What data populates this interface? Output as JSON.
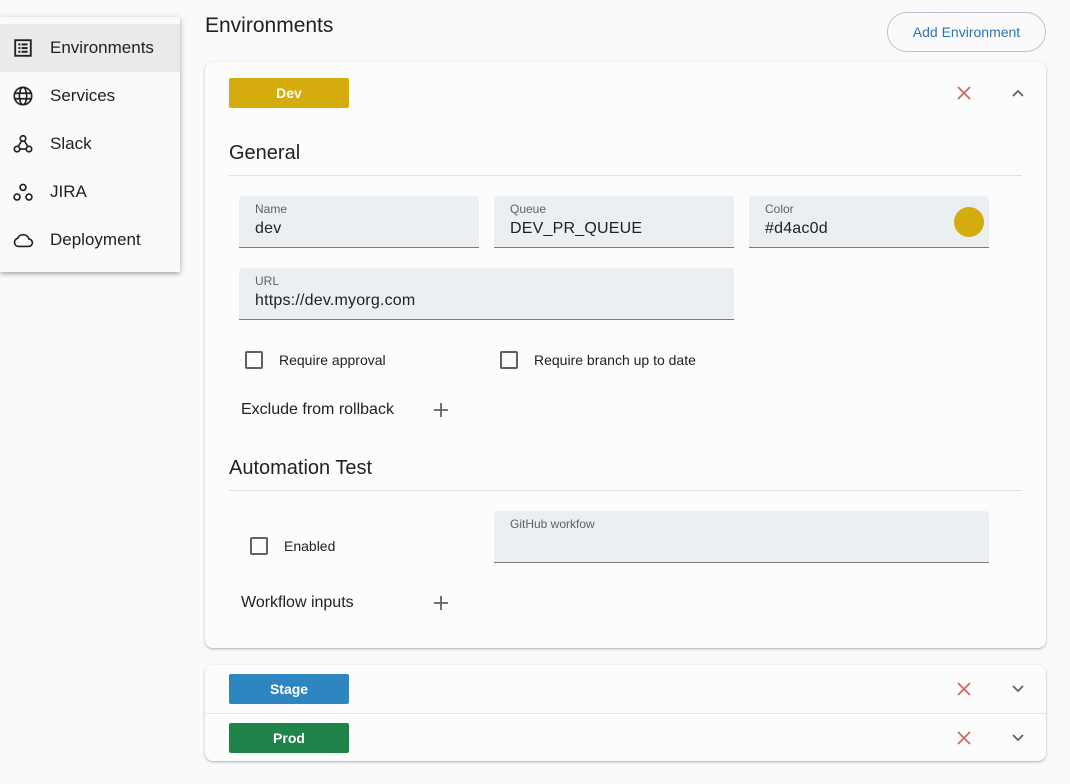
{
  "sidebar": {
    "items": [
      {
        "label": "Environments",
        "icon": "list-icon",
        "active": true
      },
      {
        "label": "Services",
        "icon": "globe-icon"
      },
      {
        "label": "Slack",
        "icon": "webhook-icon"
      },
      {
        "label": "JIRA",
        "icon": "hub-icon"
      },
      {
        "label": "Deployment",
        "icon": "cloud-icon"
      }
    ]
  },
  "header": {
    "title": "Environments",
    "add_button": "Add Environment"
  },
  "environments": [
    {
      "chip": "Dev",
      "color": "#d4ac0d",
      "expanded": true,
      "general": {
        "title": "General",
        "name": {
          "label": "Name",
          "value": "dev"
        },
        "queue": {
          "label": "Queue",
          "value": "DEV_PR_QUEUE"
        },
        "color_field": {
          "label": "Color",
          "value": "#d4ac0d"
        },
        "url": {
          "label": "URL",
          "value": "https://dev.myorg.com"
        },
        "require_approval": "Require approval",
        "require_branch": "Require branch up to date",
        "exclude_rollback": "Exclude from rollback"
      },
      "automation": {
        "title": "Automation Test",
        "enabled": "Enabled",
        "workflow": {
          "label": "GitHub workfow",
          "value": ""
        },
        "workflow_inputs": "Workflow inputs"
      }
    },
    {
      "chip": "Stage",
      "color": "#2e86c1",
      "expanded": false
    },
    {
      "chip": "Prod",
      "color": "#1e8449",
      "expanded": false
    }
  ],
  "accent": {
    "delete_icon": "#c0392b",
    "button_text": "#2e74b5"
  }
}
